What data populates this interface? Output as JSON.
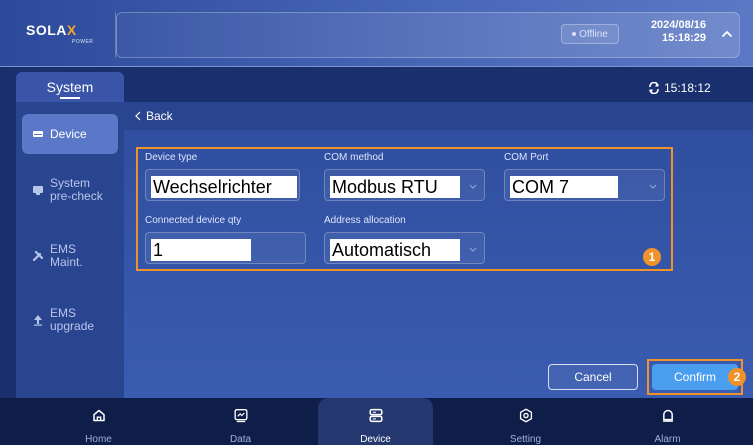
{
  "header": {
    "brand": "SOLA",
    "brand_x": "X",
    "brand_sub": "POWER",
    "status": "Offline",
    "date": "2024/08/16",
    "time": "15:18:29"
  },
  "sidebar": {
    "title": "System",
    "items": [
      {
        "label": "Device",
        "icon": "device-icon",
        "active": true
      },
      {
        "label": "System pre-check",
        "icon": "monitor-icon",
        "active": false
      },
      {
        "label": "EMS Maint.",
        "icon": "tools-icon",
        "active": false
      },
      {
        "label": "EMS upgrade",
        "icon": "upload-icon",
        "active": false
      }
    ]
  },
  "main": {
    "refresh_time": "15:18:12",
    "back_label": "Back",
    "form": {
      "device_type_label": "Device type",
      "device_type_value": "Wechselrichter",
      "com_method_label": "COM method",
      "com_method_value": "Modbus RTU",
      "com_port_label": "COM Port",
      "com_port_value": "COM 7",
      "qty_label": "Connected device qty",
      "qty_value": "1",
      "address_label": "Address allocation",
      "address_value": "Automatisch"
    },
    "badge1": "1",
    "badge2": "2",
    "cancel_label": "Cancel",
    "confirm_label": "Confirm"
  },
  "bottom_nav": [
    {
      "label": "Home",
      "icon": "home-icon"
    },
    {
      "label": "Data",
      "icon": "chart-icon"
    },
    {
      "label": "Device",
      "icon": "device-icon",
      "active": true
    },
    {
      "label": "Setting",
      "icon": "setting-icon"
    },
    {
      "label": "Alarm",
      "icon": "alarm-icon"
    }
  ],
  "colors": {
    "accent_orange": "#f0922a",
    "confirm_blue": "#4a9ef0",
    "background": "#1a2f6e"
  }
}
